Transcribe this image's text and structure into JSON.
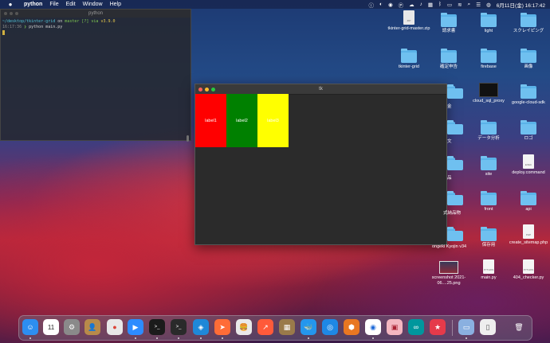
{
  "menubar": {
    "apple": "",
    "items": [
      "python",
      "File",
      "Edit",
      "Window",
      "Help"
    ],
    "clock": "6月11日(金) 16:17:42"
  },
  "terminal": {
    "title": "python",
    "line1_path": "~/desktop/tkinter-grid",
    "line1_on": "on",
    "line1_branch": "master [?] via",
    "line1_ver": "v3.9.0",
    "line2_time": "16:17:36",
    "line2_cmd": "python main.py"
  },
  "tk_window": {
    "title": "tk",
    "labels": [
      {
        "text": "label1",
        "color": "#ff0000"
      },
      {
        "text": "label2",
        "color": "#008000"
      },
      {
        "text": "label3",
        "color": "#ffff00"
      }
    ]
  },
  "desktop": {
    "col1": [
      {
        "name": "tkinter-grid-master.zip",
        "type": "zip",
        "ext": "ZIP"
      },
      {
        "name": "tkinter-grid",
        "type": "folder"
      },
      {
        "name": "cloud_sql_proxy",
        "type": "exec"
      },
      {
        "name": "screenshot 2021-06....25.png",
        "type": "image"
      }
    ],
    "col2": [
      {
        "name": "請求書",
        "type": "folder"
      },
      {
        "name": "確定申告",
        "type": "folder"
      },
      {
        "name": "データ分析",
        "type": "folder"
      },
      {
        "name": "site",
        "type": "folder"
      },
      {
        "name": "front",
        "type": "folder"
      },
      {
        "name": "保存用",
        "type": "folder"
      },
      {
        "name": "main.py",
        "type": "doc",
        "ext": "PYTHON"
      }
    ],
    "col3": [
      {
        "name": "スクレイピング",
        "type": "folder"
      },
      {
        "name": "firebase",
        "type": "folder"
      },
      {
        "name": "google-cloud-sdk",
        "type": "folder"
      },
      {
        "name": "ロゴ",
        "type": "folder"
      },
      {
        "name": "deploy.command",
        "type": "doc",
        "ext": "EXEC"
      },
      {
        "name": "api",
        "type": "folder"
      },
      {
        "name": "create_sitemap.php",
        "type": "doc",
        "ext": "PHP"
      },
      {
        "name": "404_checker.py",
        "type": "doc",
        "ext": "PYTHON"
      }
    ],
    "col_light": {
      "name": "light",
      "type": "folder"
    },
    "col_gazou": {
      "name": "画像",
      "type": "folder"
    },
    "partials": [
      "金",
      "文",
      "品",
      "式納品物",
      "ongeki Kyojin v34"
    ]
  },
  "dock": {
    "apps": [
      {
        "name": "finder",
        "glyph": "☺",
        "color": "#2d8ef0"
      },
      {
        "name": "calendar",
        "glyph": "11",
        "color": "#ffffff"
      },
      {
        "name": "system-preferences",
        "glyph": "⚙",
        "color": "#8a8a8a"
      },
      {
        "name": "contacts",
        "glyph": "👤",
        "color": "#b88a4a"
      },
      {
        "name": "chrome",
        "glyph": "●",
        "color": "#e8e8e8"
      },
      {
        "name": "zoom",
        "glyph": "▶",
        "color": "#2d8cff"
      },
      {
        "name": "terminal",
        "glyph": ">_",
        "color": "#1b1b1b"
      },
      {
        "name": "terminal2",
        "glyph": ">_",
        "color": "#2a2a2a"
      },
      {
        "name": "vscode",
        "glyph": "◈",
        "color": "#1f88d8"
      },
      {
        "name": "postman",
        "glyph": "➤",
        "color": "#ff6c37"
      },
      {
        "name": "tableplus",
        "glyph": "🍔",
        "color": "#e9e9e9"
      },
      {
        "name": "activity",
        "glyph": "↗",
        "color": "#ff5a3a"
      },
      {
        "name": "archiver",
        "glyph": "▦",
        "color": "#9a7a4a"
      },
      {
        "name": "docker",
        "glyph": "🐳",
        "color": "#2496ed"
      },
      {
        "name": "safari",
        "glyph": "◎",
        "color": "#1e88e5"
      },
      {
        "name": "sourcetree",
        "glyph": "⬢",
        "color": "#e87722"
      },
      {
        "name": "dropbox",
        "glyph": "◉",
        "color": "#ffffff"
      },
      {
        "name": "preview",
        "glyph": "▣",
        "color": "#f4b6c0"
      },
      {
        "name": "arduino",
        "glyph": "∞",
        "color": "#00979d"
      },
      {
        "name": "timing",
        "glyph": "★",
        "color": "#e53a4a"
      }
    ],
    "right": [
      {
        "name": "screenshot",
        "glyph": "▭",
        "color": "#8ab0e0"
      },
      {
        "name": "document",
        "glyph": "▯",
        "color": "#eeeeee"
      },
      {
        "name": "trash",
        "glyph": "🗑",
        "color": "#9a9a9a"
      }
    ]
  }
}
